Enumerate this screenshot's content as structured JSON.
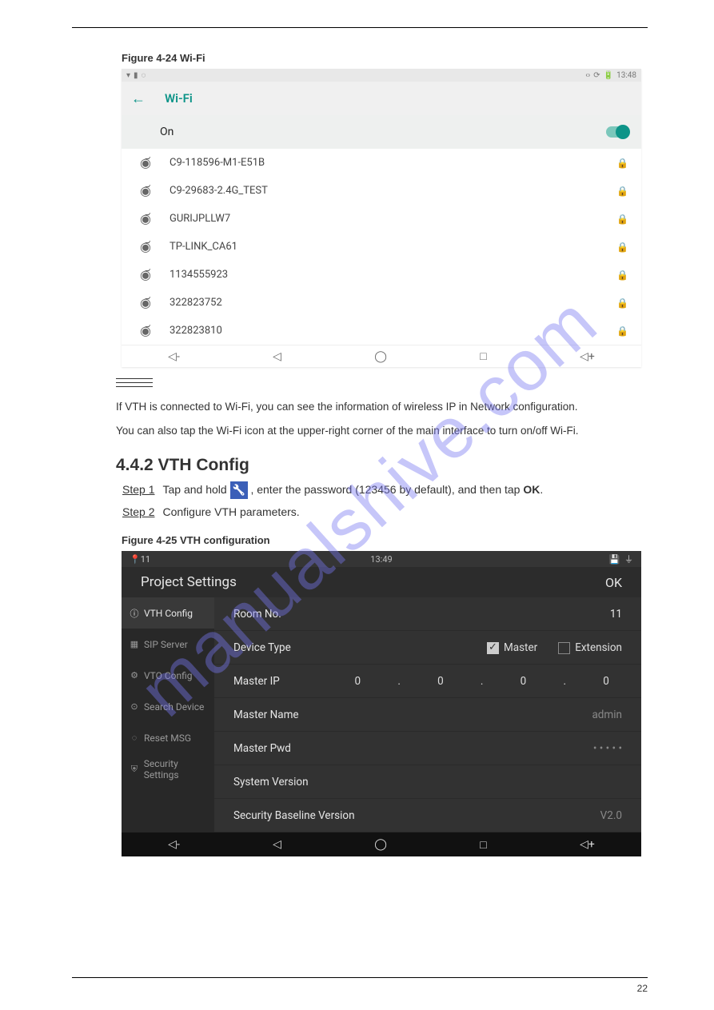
{
  "doc": {
    "header_left": "",
    "header_right": "",
    "figure1_caption": "Figure 4-24 Wi-Fi",
    "figure2_caption": "Figure 4-25 VTH configuration",
    "section_title": "4.4.2 VTH Config"
  },
  "watermark": "manualshive.com",
  "wifi": {
    "statusbar_time": "13:48",
    "title": "Wi-Fi",
    "on_label": "On",
    "networks": [
      {
        "signal": 4,
        "name": "C9-118596-M1-E51B",
        "locked": true
      },
      {
        "signal": 4,
        "name": "C9-29683-2.4G_TEST",
        "locked": true
      },
      {
        "signal": 4,
        "name": "GURIJPLLW7",
        "locked": true
      },
      {
        "signal": 4,
        "name": "TP-LINK_CA61",
        "locked": true
      },
      {
        "signal": 4,
        "name": "1134555923",
        "locked": true
      },
      {
        "signal": 3,
        "name": "322823752",
        "locked": true
      },
      {
        "signal": 3,
        "name": "322823810",
        "locked": true
      }
    ]
  },
  "note": {
    "p1": "If VTH is connected to Wi-Fi, you can see the information of wireless IP in Network configuration.",
    "p2": "You can also tap the Wi-Fi icon at the upper-right corner of the main interface to turn on/off Wi-Fi."
  },
  "steps": {
    "step1_num": "Step 1",
    "step1_before": "Tap and hold ",
    "step1_after": ", enter the password (123456 by default), and then tap ",
    "step1_ok": "OK",
    "step2_num": "Step 2",
    "step2_txt": "Configure VTH parameters."
  },
  "proj": {
    "time": "13:49",
    "header_title": "Project Settings",
    "ok": "OK",
    "status_loc": "11",
    "side": [
      {
        "icon": "ⓘ",
        "label": "VTH Config",
        "active": true
      },
      {
        "icon": "▦",
        "label": "SIP Server",
        "active": false
      },
      {
        "icon": "⚙",
        "label": "VTO Config",
        "active": false
      },
      {
        "icon": "⊙",
        "label": "Search Device",
        "active": false
      },
      {
        "icon": "◌",
        "label": "Reset MSG",
        "active": false
      },
      {
        "icon": "⛨",
        "label": "Security Settings",
        "active": false
      }
    ],
    "rows": {
      "room_no_label": "Room No.",
      "room_no_value": "11",
      "device_type_label": "Device Type",
      "master_cb": "Master",
      "extension_cb": "Extension",
      "master_ip_label": "Master IP",
      "ip_octets": [
        "0",
        "0",
        "0",
        "0"
      ],
      "master_name_label": "Master Name",
      "master_name_value": "admin",
      "master_pwd_label": "Master Pwd",
      "master_pwd_value": "• • • • •",
      "sys_ver_label": "System Version",
      "sys_ver_value": "",
      "sec_base_label": "Security Baseline Version",
      "sec_base_value": "V2.0"
    }
  },
  "footer": {
    "left": "",
    "right": "22"
  }
}
